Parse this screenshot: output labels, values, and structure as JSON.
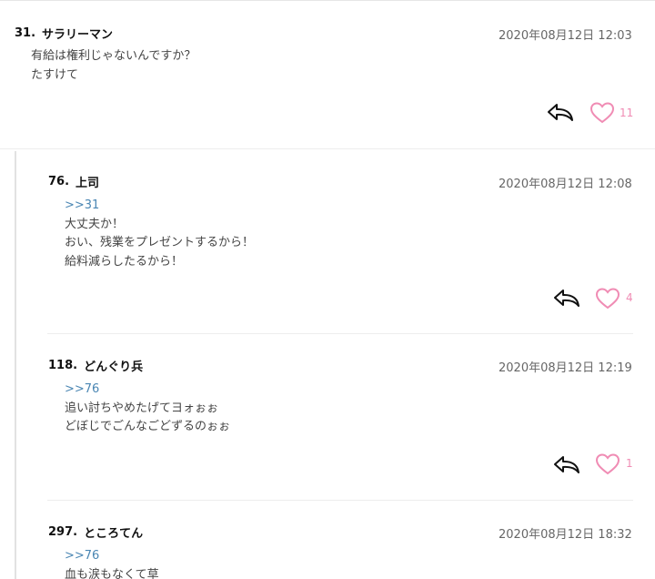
{
  "comments": [
    {
      "number": "31.",
      "name": "サラリーマン",
      "date": "2020年08月12日 12:03",
      "anchor": "",
      "lines": [
        "有給は権利じゃないんですか？",
        "たすけて"
      ],
      "likes": "11"
    },
    {
      "number": "76.",
      "name": "上司",
      "date": "2020年08月12日 12:08",
      "anchor": ">>31",
      "lines": [
        "大丈夫か！",
        "おい、残業をプレゼントするから！",
        "給料減らしたるから！"
      ],
      "likes": "4"
    },
    {
      "number": "118.",
      "name": "どんぐり兵",
      "date": "2020年08月12日 12:19",
      "anchor": ">>76",
      "lines": [
        "追い討ちやめたげてヨォぉぉ",
        "どぼじでごんなごどずるのぉぉ"
      ],
      "likes": "1"
    },
    {
      "number": "297.",
      "name": "ところてん",
      "date": "2020年08月12日 18:32",
      "anchor": ">>76",
      "lines": [
        "血も涙もなくて草"
      ],
      "likes": ""
    }
  ],
  "icons": {
    "reply": "reply-arrow-icon",
    "like": "heart-icon"
  },
  "colors": {
    "like": "#f08cb4",
    "anchor": "#4a86b3",
    "date": "#666666"
  }
}
